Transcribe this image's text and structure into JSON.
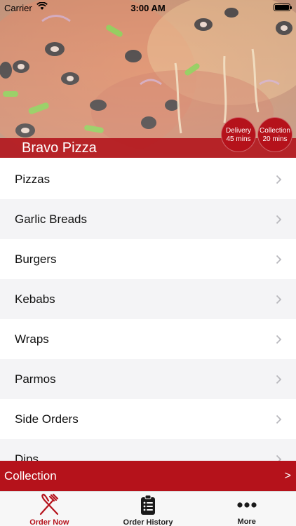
{
  "status_bar": {
    "carrier": "Carrier",
    "time": "3:00 AM"
  },
  "hero": {
    "restaurant_name": "Bravo Pizza",
    "delivery": {
      "label": "Delivery",
      "time": "45 mins"
    },
    "collection": {
      "label": "Collection",
      "time": "20 mins"
    }
  },
  "menu": {
    "items": [
      {
        "label": "Pizzas"
      },
      {
        "label": "Garlic Breads"
      },
      {
        "label": "Burgers"
      },
      {
        "label": "Kebabs"
      },
      {
        "label": "Wraps"
      },
      {
        "label": "Parmos"
      },
      {
        "label": "Side Orders"
      },
      {
        "label": "Dips"
      }
    ]
  },
  "order_mode": {
    "label": "Collection",
    "arrow": ">"
  },
  "tabs": [
    {
      "label": "Order Now",
      "icon": "fork-knife-icon",
      "active": true
    },
    {
      "label": "Order History",
      "icon": "clipboard-icon",
      "active": false
    },
    {
      "label": "More",
      "icon": "more-dots-icon",
      "active": false
    }
  ],
  "colors": {
    "brand_red": "#b5121b",
    "active_tab": "#b5121b"
  }
}
